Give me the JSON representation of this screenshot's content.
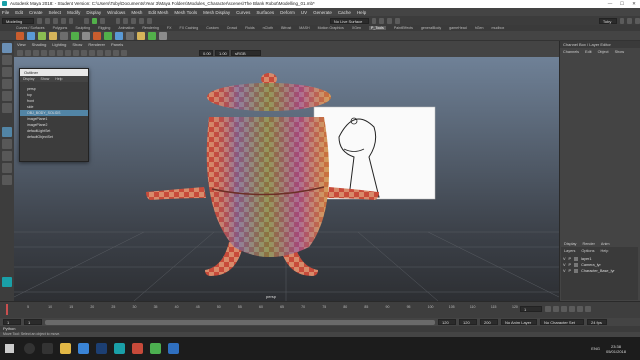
{
  "window": {
    "title": "Autodesk Maya 2018: - Student Version: C:\\Users\\Toby\\Documents\\Year 3\\Maya Folders\\Modules_Character\\scenes\\The Blank Robot\\Modelling_01.mb*",
    "minimize": "—",
    "maximize": "☐",
    "close": "✕"
  },
  "menus": [
    "File",
    "Edit",
    "Create",
    "Select",
    "Modify",
    "Display",
    "Windows",
    "Mesh",
    "Edit Mesh",
    "Mesh Tools",
    "Mesh Display",
    "Curves",
    "Surfaces",
    "Deform",
    "UV",
    "Generate",
    "Cache",
    "Help"
  ],
  "statusline": {
    "menuset": "Modeling",
    "live": "No Live Surface",
    "user": "Toby"
  },
  "shelf_tabs": [
    "Curves / Surfaces",
    "Polygons",
    "Sculpting",
    "Rigging",
    "Animation",
    "Rendering",
    "FX",
    "FX Caching",
    "Custom",
    "Crowd",
    "Fluids",
    "nCloth",
    "Bifrost",
    "MASH",
    "Motion Graphics",
    "XGen",
    "P_Tools",
    "PaintEffects",
    "generalBody",
    "gameHead",
    "hGen",
    "mudbox"
  ],
  "shelf_active": "P_Tools",
  "viewport": {
    "menus": [
      "View",
      "Shading",
      "Lighting",
      "Show",
      "Renderer",
      "Panels"
    ],
    "gamma": "sRGB gamma",
    "gamma_value": "1.00",
    "value1": "0.00",
    "camera": "persp"
  },
  "outliner": {
    "title": "Outliner",
    "menus": [
      "Display",
      "Show",
      "Help"
    ],
    "items": [
      "persp",
      "top",
      "front",
      "side",
      "OBJ_BODY_SOLIDS",
      "imagePlane1",
      "imagePlane2",
      "defaultLightSet",
      "defaultObjectSet"
    ],
    "selected": "OBJ_BODY_SOLIDS"
  },
  "channelbox": {
    "title": "Channel Box / Layer Editor",
    "menus": [
      "Channels",
      "Edit",
      "Object",
      "Show"
    ]
  },
  "layers": {
    "tabs": [
      "Display",
      "Render",
      "Anim"
    ],
    "menus": [
      "Layers",
      "Options",
      "Help"
    ],
    "items": [
      {
        "v": "V",
        "p": "P",
        "name": "layer1"
      },
      {
        "v": "V",
        "p": "P",
        "name": "Camera_lyr"
      },
      {
        "v": "V",
        "p": "P",
        "name": "Character_Base_lyr"
      }
    ]
  },
  "time": {
    "ticks": [
      "1",
      "5",
      "10",
      "15",
      "20",
      "25",
      "30",
      "35",
      "40",
      "45",
      "50",
      "55",
      "60",
      "65",
      "70",
      "75",
      "80",
      "85",
      "90",
      "95",
      "100",
      "105",
      "110",
      "115",
      "120"
    ],
    "current": "1",
    "start": "1",
    "start2": "1",
    "end": "120",
    "end2": "120",
    "end3": "200",
    "anim_layer": "No Anim Layer",
    "char_set": "No Character Set",
    "fps": "24 fps"
  },
  "mel": {
    "label": "Python"
  },
  "help": {
    "text": "Move Tool: Select an object to move."
  },
  "taskbar": {
    "time": "23:38",
    "date": "05/01/2018",
    "lang": "ENG"
  },
  "colors": {
    "accent": "#5285a6",
    "active_green": "#52b04a"
  }
}
